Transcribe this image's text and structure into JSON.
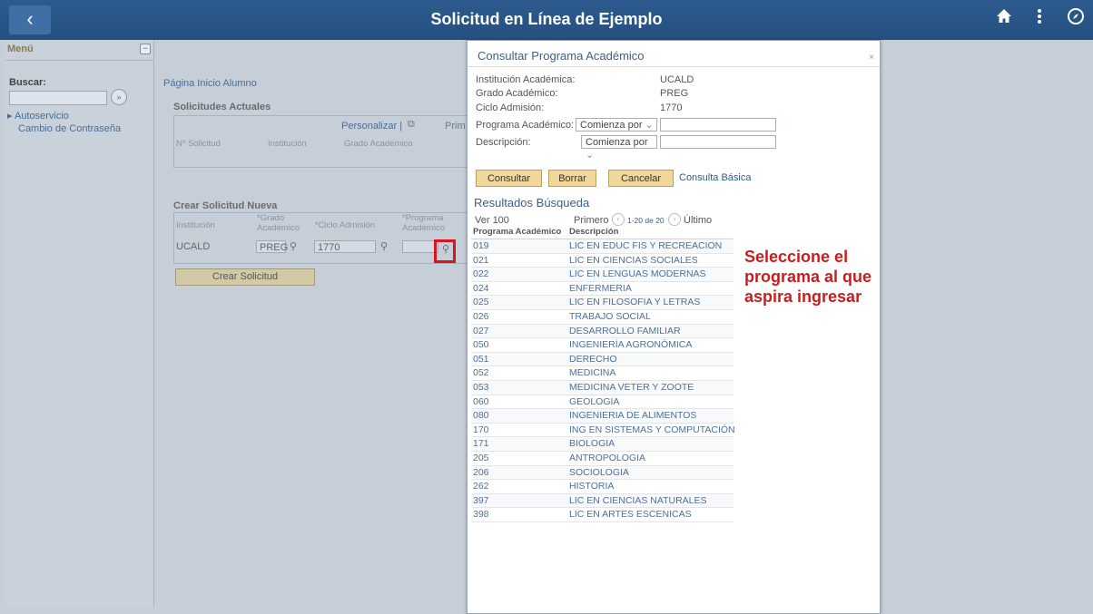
{
  "topbar": {
    "title": "Solicitud en Línea de Ejemplo",
    "back_icon": "‹",
    "home_icon": "home-icon",
    "more_icon": "more-vertical-icon",
    "navbar_icon": "compass-icon"
  },
  "sidebar": {
    "header": "Menú",
    "search_label": "Buscar:",
    "search_value": "",
    "items": [
      {
        "label": "Autoservicio"
      },
      {
        "label": "Cambio de Contraseña"
      }
    ]
  },
  "main": {
    "page_title": "Página Inicio Alumno",
    "current_title": "Solicitudes Actuales",
    "personalize": "Personalizar |",
    "first_truncated": "Prim",
    "current_columns": [
      "Nº Solicitud",
      "Institución",
      "Grado Académico"
    ],
    "new_title": "Crear Solicitud Nueva",
    "new_columns": [
      "Institución",
      "*Grado\nAcadémico",
      "*Ciclo Admisión",
      "*Programa\nAcadémico"
    ],
    "new_row": {
      "institution": "UCALD",
      "grado": "PREG",
      "ciclo": "1770",
      "programa": ""
    },
    "create_button": "Crear Solicitud"
  },
  "modal": {
    "title": "Consultar Programa Académico",
    "close": "×",
    "fields": [
      {
        "label": "Institución Académica:",
        "value": "UCALD"
      },
      {
        "label": "Grado Académico:",
        "value": "PREG"
      },
      {
        "label": "Ciclo Admisión:",
        "value": "1770"
      }
    ],
    "search_fields": [
      {
        "label": "Programa Académico:",
        "operator": "Comienza por",
        "value": ""
      },
      {
        "label": "Descripción:",
        "operator": "Comienza por",
        "value": ""
      }
    ],
    "buttons": {
      "consultar": "Consultar",
      "borrar": "Borrar",
      "cancelar": "Cancelar",
      "basic": "Consulta Básica"
    },
    "results_title": "Resultados Búsqueda",
    "pager": {
      "view": "Ver 100",
      "first": "Primero",
      "range": "1-20 de 20",
      "last": "Último"
    },
    "results_header": {
      "col1": "Programa Académico",
      "col2": "Descripción"
    },
    "results": [
      {
        "code": "019",
        "desc": "LIC EN EDUC FIS Y RECREACION"
      },
      {
        "code": "021",
        "desc": "LIC EN CIENCIAS SOCIALES"
      },
      {
        "code": "022",
        "desc": "LIC EN LENGUAS MODERNAS"
      },
      {
        "code": "024",
        "desc": "ENFERMERIA"
      },
      {
        "code": "025",
        "desc": "LIC EN FILOSOFIA Y LETRAS"
      },
      {
        "code": "026",
        "desc": "TRABAJO SOCIAL"
      },
      {
        "code": "027",
        "desc": "DESARROLLO FAMILIAR"
      },
      {
        "code": "050",
        "desc": "INGENIERÍA AGRONÓMICA"
      },
      {
        "code": "051",
        "desc": "DERECHO"
      },
      {
        "code": "052",
        "desc": "MEDICINA"
      },
      {
        "code": "053",
        "desc": "MEDICINA VETER Y ZOOTE"
      },
      {
        "code": "060",
        "desc": "GEOLOGIA"
      },
      {
        "code": "080",
        "desc": "INGENIERIA DE ALIMENTOS"
      },
      {
        "code": "170",
        "desc": "ING EN SISTEMAS Y COMPUTACIÓN"
      },
      {
        "code": "171",
        "desc": "BIOLOGIA"
      },
      {
        "code": "205",
        "desc": "ANTROPOLOGIA"
      },
      {
        "code": "206",
        "desc": "SOCIOLOGIA"
      },
      {
        "code": "262",
        "desc": "HISTORIA"
      },
      {
        "code": "397",
        "desc": "LIC EN CIENCIAS NATURALES"
      },
      {
        "code": "398",
        "desc": "LIC EN ARTES ESCENICAS"
      }
    ]
  },
  "annotation": "Seleccione el programa al que aspira ingresar"
}
